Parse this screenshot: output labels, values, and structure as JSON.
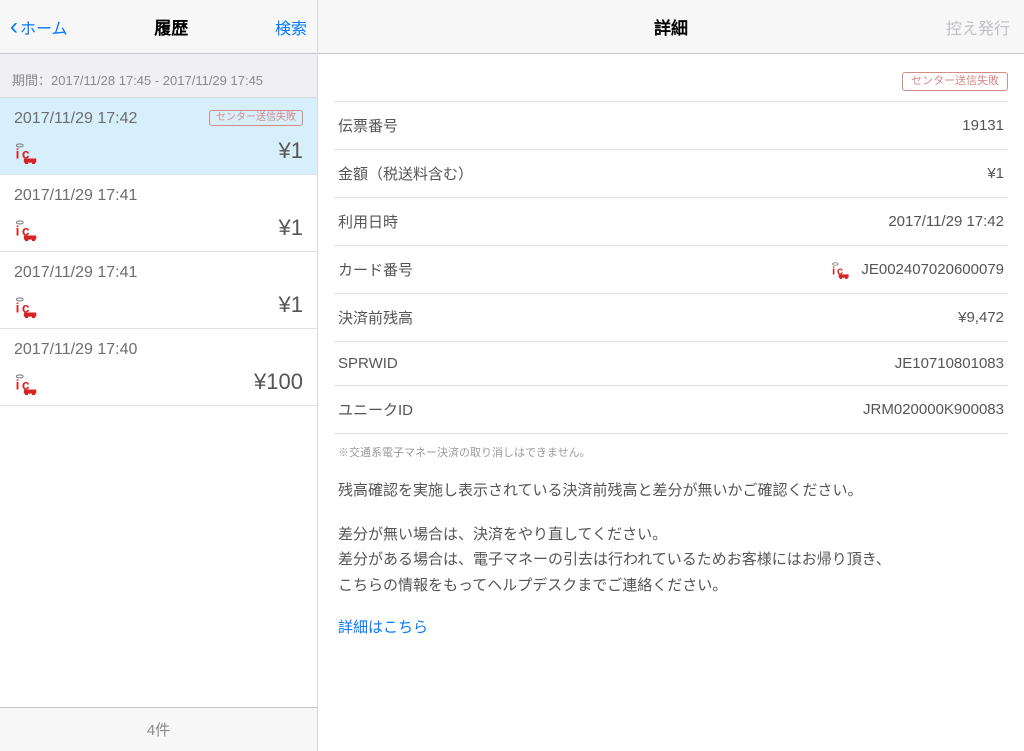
{
  "left": {
    "back_label": "ホーム",
    "title": "履歴",
    "search_label": "検索",
    "period_text": "期間：2017/11/28 17:45 - 2017/11/29 17:45",
    "footer_count": "4件",
    "items": [
      {
        "datetime": "2017/11/29 17:42",
        "amount": "¥1",
        "badge": "センター送信失敗",
        "selected": true
      },
      {
        "datetime": "2017/11/29 17:41",
        "amount": "¥1",
        "badge": "",
        "selected": false
      },
      {
        "datetime": "2017/11/29 17:41",
        "amount": "¥1",
        "badge": "",
        "selected": false
      },
      {
        "datetime": "2017/11/29 17:40",
        "amount": "¥100",
        "badge": "",
        "selected": false
      }
    ]
  },
  "right": {
    "title": "詳細",
    "reissue_label": "控え発行",
    "status_badge": "センター送信失敗",
    "rows": [
      {
        "label": "伝票番号",
        "value": "19131"
      },
      {
        "label": "金額（税送料含む）",
        "value": "¥1"
      },
      {
        "label": "利用日時",
        "value": "2017/11/29 17:42"
      },
      {
        "label": "カード番号",
        "value": "JE002407020600079",
        "icon": true
      },
      {
        "label": "決済前残高",
        "value": "¥9,472"
      },
      {
        "label": "SPRWID",
        "value": "JE10710801083"
      },
      {
        "label": "ユニークID",
        "value": "JRM020000K900083"
      }
    ],
    "note_small": "※交通系電子マネー決済の取り消しはできません。",
    "note1": "残高確認を実施し表示されている決済前残高と差分が無いかご確認ください。",
    "note2": "差分が無い場合は、決済をやり直してください。\n差分がある場合は、電子マネーの引去は行われているためお客様にはお帰り頂き、\nこちらの情報をもってヘルプデスクまでご連絡ください。",
    "link_more": "詳細はこちら"
  }
}
